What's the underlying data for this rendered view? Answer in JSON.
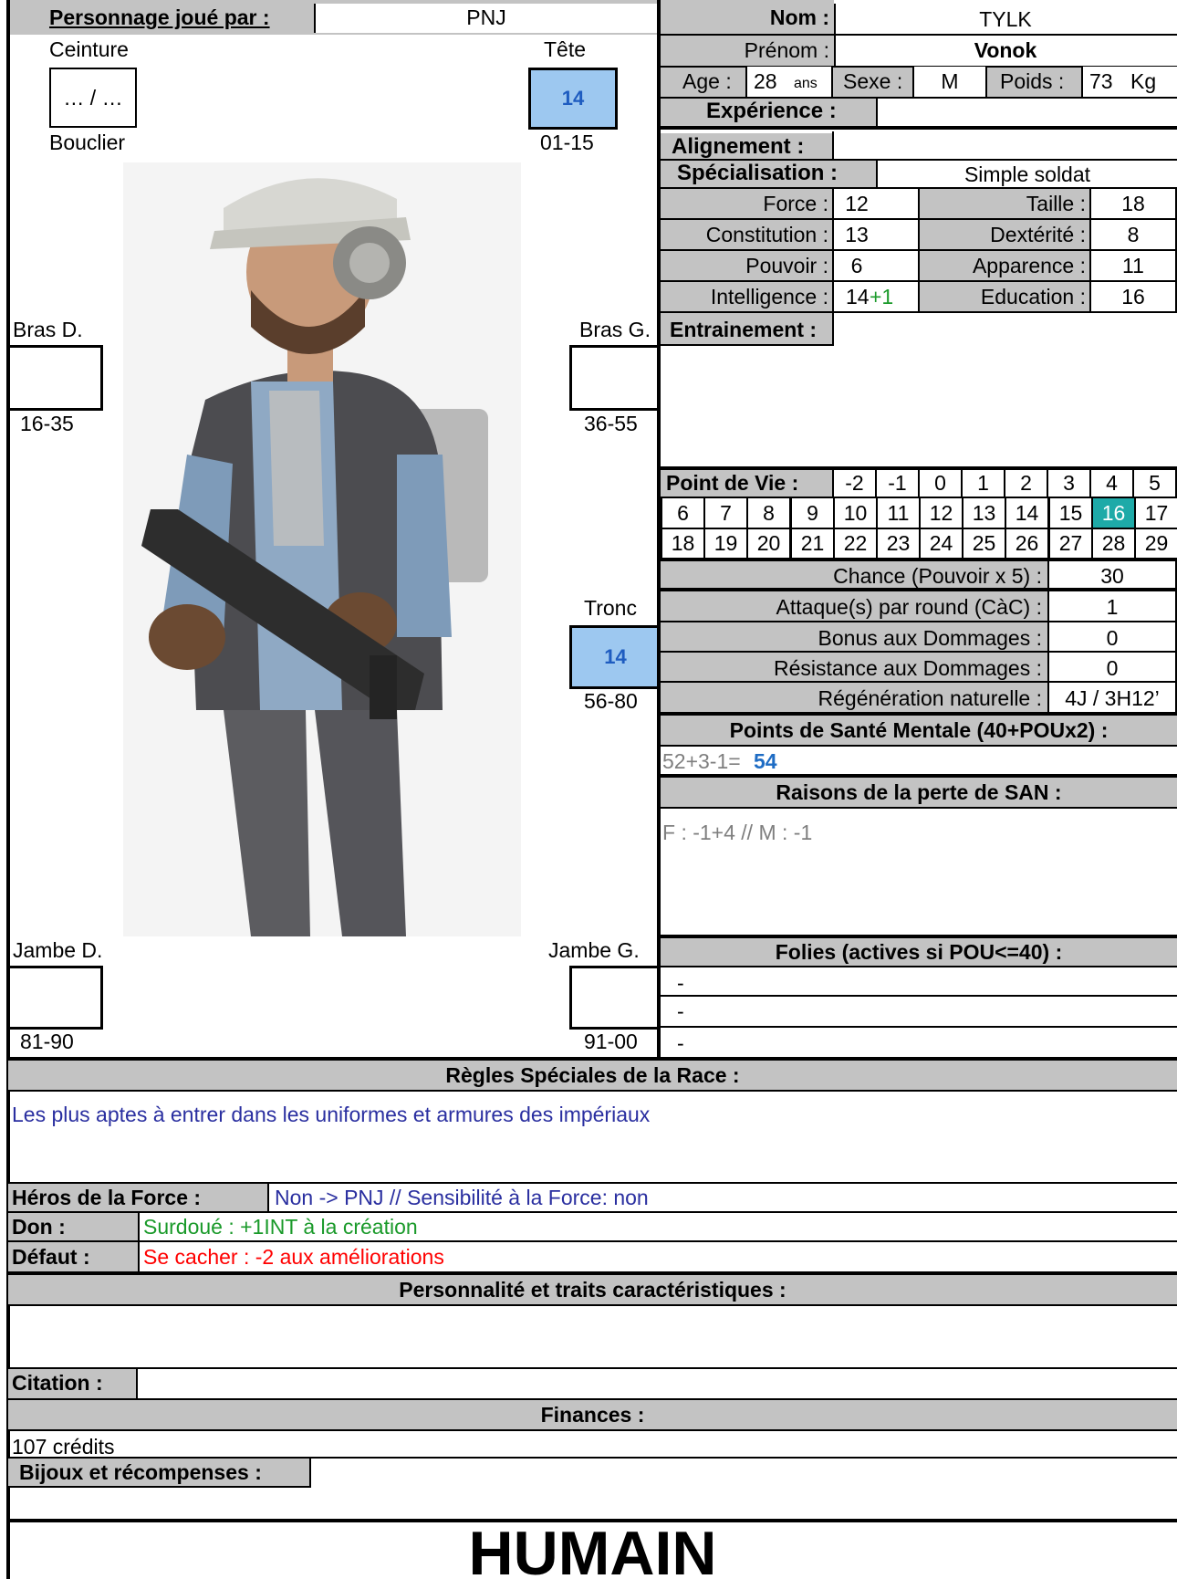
{
  "header": {
    "player_label": "Personnage joué par :",
    "player_value": "PNJ",
    "name_label": "Nom :",
    "name_value": "TYLK",
    "firstname_label": "Prénom :",
    "firstname_value": "Vonok",
    "age_label": "Age :",
    "age_value": "28",
    "age_unit": "ans",
    "sex_label": "Sexe :",
    "sex_value": "M",
    "weight_label": "Poids :",
    "weight_value": "73",
    "weight_unit": "Kg",
    "experience_label": "Expérience :",
    "alignment_label": "Alignement :",
    "specialisation_label": "Spécialisation :",
    "specialisation_value": "Simple soldat"
  },
  "body_locations": {
    "belt_label": "Ceinture",
    "belt_value": "… / …",
    "shield_label": "Bouclier",
    "head_label": "Tête",
    "head_value": "14",
    "head_range": "01-15",
    "right_arm_label": "Bras D.",
    "right_arm_range": "16-35",
    "left_arm_label": "Bras G.",
    "left_arm_range": "36-55",
    "trunk_label": "Tronc",
    "trunk_value": "14",
    "trunk_range": "56-80",
    "right_leg_label": "Jambe D.",
    "right_leg_range": "81-90",
    "left_leg_label": "Jambe G.",
    "left_leg_range": "91-00"
  },
  "characteristics": [
    {
      "label": "Force :",
      "value": "12",
      "label2": "Taille :",
      "value2": "18"
    },
    {
      "label": "Constitution :",
      "value": "13",
      "label2": "Dextérité :",
      "value2": "8"
    },
    {
      "label": "Pouvoir :",
      "value": "6",
      "label2": "Apparence :",
      "value2": "11"
    },
    {
      "label": "Intelligence :",
      "value": "14",
      "bonus": "+1",
      "label2": "Education :",
      "value2": "16"
    }
  ],
  "training_label": "Entrainement :",
  "hit_points": {
    "label": "Point de Vie :",
    "row1": [
      "-2",
      "-1",
      "0",
      "1",
      "2",
      "3",
      "4",
      "5"
    ],
    "row2": [
      "6",
      "7",
      "8",
      "9",
      "10",
      "11",
      "12",
      "13",
      "14",
      "15",
      "16",
      "17"
    ],
    "row3": [
      "18",
      "19",
      "20",
      "21",
      "22",
      "23",
      "24",
      "25",
      "26",
      "27",
      "28",
      "29"
    ],
    "current": "16",
    "highlight_color": "#1eaaa8"
  },
  "derived": [
    {
      "label": "Chance (Pouvoir x 5) :",
      "value": "30"
    },
    {
      "label": "Attaque(s) par round (CàC) :",
      "value": "1"
    },
    {
      "label": "Bonus aux Dommages :",
      "value": "0"
    },
    {
      "label": "Résistance aux Dommages :",
      "value": "0"
    },
    {
      "label": "Régénération naturelle :",
      "value": "4J / 3H12’"
    }
  ],
  "sanity": {
    "label": "Points de Santé Mentale (40+POUx2) :",
    "formula": "52+3-1=",
    "total": "54",
    "loss_label": "Raisons de la perte de SAN :",
    "loss_value": "F : -1+4 // M : -1",
    "madness_label": "Folies (actives si POU<=40) :",
    "madness": [
      "-",
      "-",
      "-"
    ]
  },
  "race_rules": {
    "label": "Règles Spéciales de la Race :",
    "value": "Les plus aptes à entrer dans les uniformes et armures des impériaux"
  },
  "force_hero": {
    "label": "Héros de la Force :",
    "value": "Non -> PNJ // Sensibilité à la Force: non"
  },
  "gift": {
    "label": "Don :",
    "value": "Surdoué : +1INT à la création"
  },
  "flaw": {
    "label": "Défaut :",
    "value": "Se cacher : -2 aux améliorations"
  },
  "personality_label": "Personnalité et traits caractéristiques :",
  "quote_label": "Citation :",
  "finances": {
    "label": "Finances :",
    "value": "107 crédits"
  },
  "jewels_label": "Bijoux et récompenses :",
  "race": "HUMAIN",
  "colors": {
    "gray": "#c3c3c3",
    "blue_text": "#2a2fa0",
    "green_text": "#1a9a2a",
    "red_text": "#ff0000",
    "hit_location": "#9dc8f0"
  }
}
